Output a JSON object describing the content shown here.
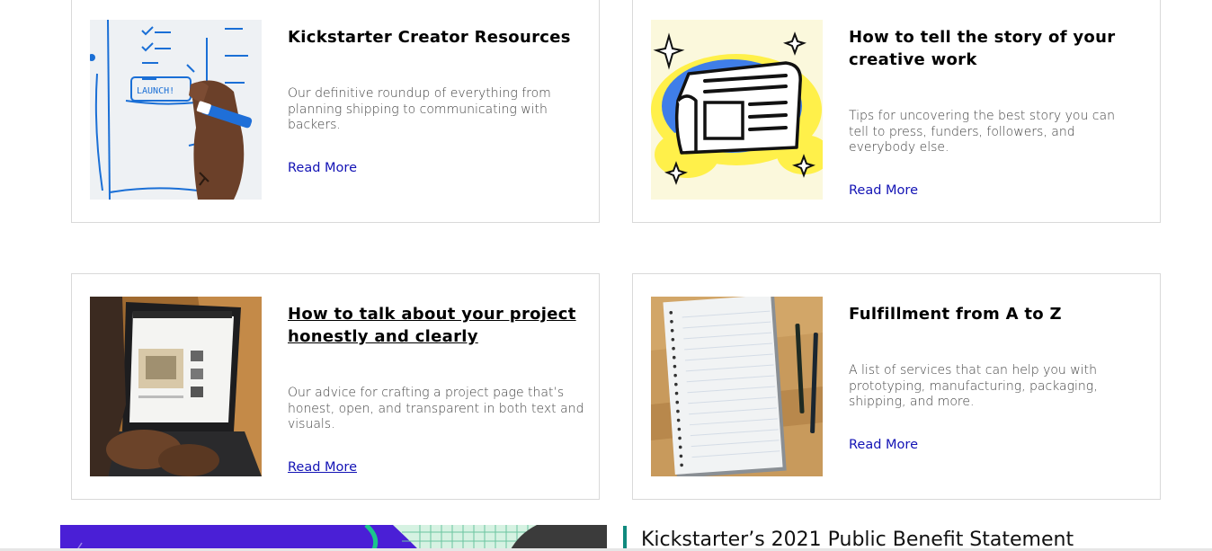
{
  "cards": [
    {
      "title": "Kickstarter Creator Resources",
      "description": "Our definitive roundup of everything from planning shipping to communicating with backers.",
      "link_label": "Read More",
      "image_text": "LAUNCH!"
    },
    {
      "title": "How to tell the story of your creative work",
      "description": "Tips for uncovering the best story you can tell to press, funders, followers, and everybody else.",
      "link_label": "Read More"
    },
    {
      "title": "How to talk about your project honestly and clearly",
      "description": "Our advice for crafting a project page that’s honest, open, and transparent in both text and visuals.",
      "link_label": "Read More"
    },
    {
      "title": "Fulfillment from A to Z",
      "description": "A list of services that can help you with prototyping, manufacturing, packaging, shipping, and more.",
      "link_label": "Read More"
    }
  ],
  "public_benefit": {
    "title": "Kickstarter’s 2021 Public Benefit Statement"
  },
  "colors": {
    "link": "#1313b5",
    "accent_bar": "#0f8a7e",
    "banner_purple": "#4a1fd6",
    "card_border": "#d9d9d9"
  }
}
